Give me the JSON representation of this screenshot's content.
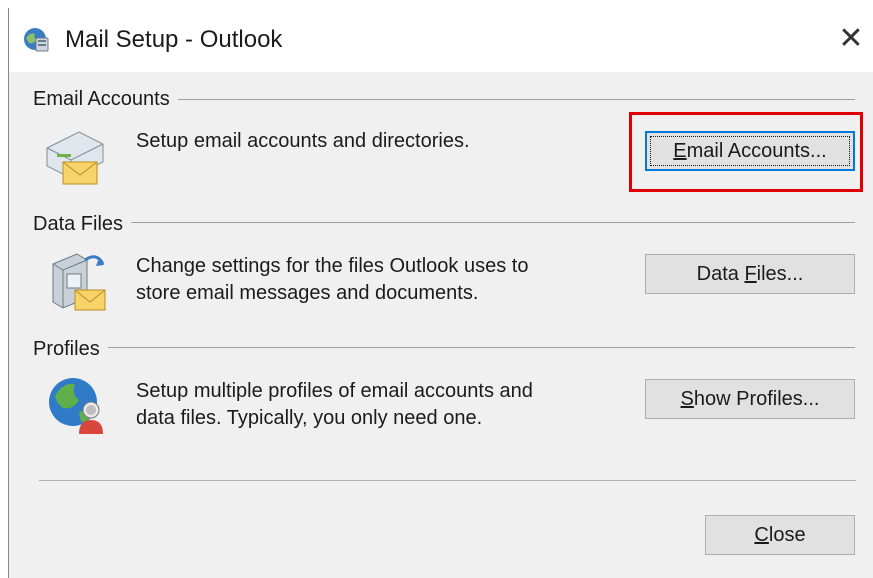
{
  "window": {
    "title": "Mail Setup - Outlook",
    "close_glyph": "✕",
    "icons": {
      "app": "outlook-mail-icon",
      "close": "close-icon"
    }
  },
  "groups": [
    {
      "title": "Email Accounts",
      "icon": "email-accounts-icon",
      "description": [
        "Setup email accounts and directories."
      ],
      "button": {
        "pre": "",
        "accel": "E",
        "post": "mail Accounts..."
      }
    },
    {
      "title": "Data Files",
      "icon": "data-files-icon",
      "description": [
        "Change settings for the files Outlook uses to",
        "store email messages and documents."
      ],
      "button": {
        "pre": "Data ",
        "accel": "F",
        "post": "iles..."
      }
    },
    {
      "title": "Profiles",
      "icon": "profiles-icon",
      "description": [
        "Setup multiple profiles of email accounts and",
        "data files. Typically, you only need one."
      ],
      "button": {
        "pre": "",
        "accel": "S",
        "post": "how Profiles..."
      }
    }
  ],
  "footer": {
    "close_button": {
      "pre": "",
      "accel": "C",
      "post": "lose"
    }
  },
  "colors": {
    "highlight": "#e00000",
    "focus": "#0078d7",
    "button_bg": "#e1e1e1",
    "dialog_bg": "#f0f0f0"
  }
}
